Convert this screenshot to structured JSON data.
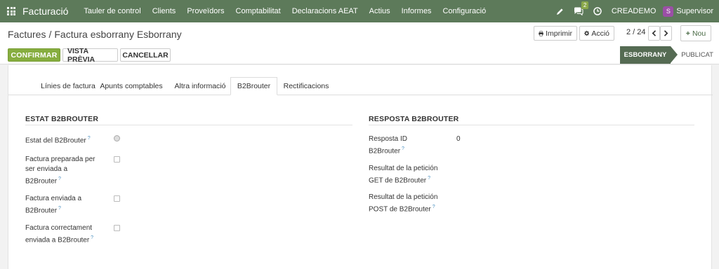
{
  "navbar": {
    "brand": "Facturació",
    "menu": [
      "Tauler de control",
      "Clients",
      "Proveïdors",
      "Comptabilitat",
      "Declaracions AEAT",
      "Actius",
      "Informes",
      "Configuració"
    ],
    "chat_count": "2",
    "company": "CREADEMO",
    "avatar_letter": "S",
    "user": "Supervisor",
    "colors": {
      "bar": "#5d7a5a",
      "avatar": "#9b4fa6",
      "badge": "#8aa84a"
    }
  },
  "breadcrumb": {
    "parent": "Factures",
    "separator": "/",
    "current": "Factura esborrany Esborrany"
  },
  "toolbar": {
    "print_label": "Imprimir",
    "action_label": "Acció",
    "pager": "2 / 24",
    "new_label": "Nou",
    "confirm_label": "CONFIRMAR",
    "preview_label": "VISTA PRÈVIA",
    "cancel_label": "CANCELLAR"
  },
  "status": {
    "active": "ESBORRANY",
    "next": "PUBLICAT"
  },
  "tabs": [
    "Línies de factura",
    "Apunts comptables",
    "Altra informació",
    "B2Brouter",
    "Rectificacions"
  ],
  "active_tab": "B2Brouter",
  "left_section": {
    "title": "ESTAT B2BROUTER",
    "fields": [
      {
        "label": "Estat del B2Brouter",
        "help": "?"
      },
      {
        "label": "Factura preparada per ser enviada a B2Brouter",
        "line1": "Factura preparada per",
        "line2": "ser enviada a",
        "line3": "B2Brouter",
        "help": "?"
      },
      {
        "line1": "Factura enviada a",
        "line2": "B2Brouter",
        "help": "?"
      },
      {
        "line1": "Factura correctament",
        "line2": "enviada a B2Brouter",
        "help": "?"
      }
    ]
  },
  "right_section": {
    "title": "RESPOSTA B2BROUTER",
    "fields": [
      {
        "line1": "Resposta ID",
        "line2": "B2Brouter",
        "help": "?",
        "value": "0"
      },
      {
        "line1": "Resultat de la petición",
        "line2": "GET de B2Brouter",
        "help": "?"
      },
      {
        "line1": "Resultat de la petición",
        "line2": "POST de B2Brouter",
        "help": "?"
      }
    ]
  }
}
